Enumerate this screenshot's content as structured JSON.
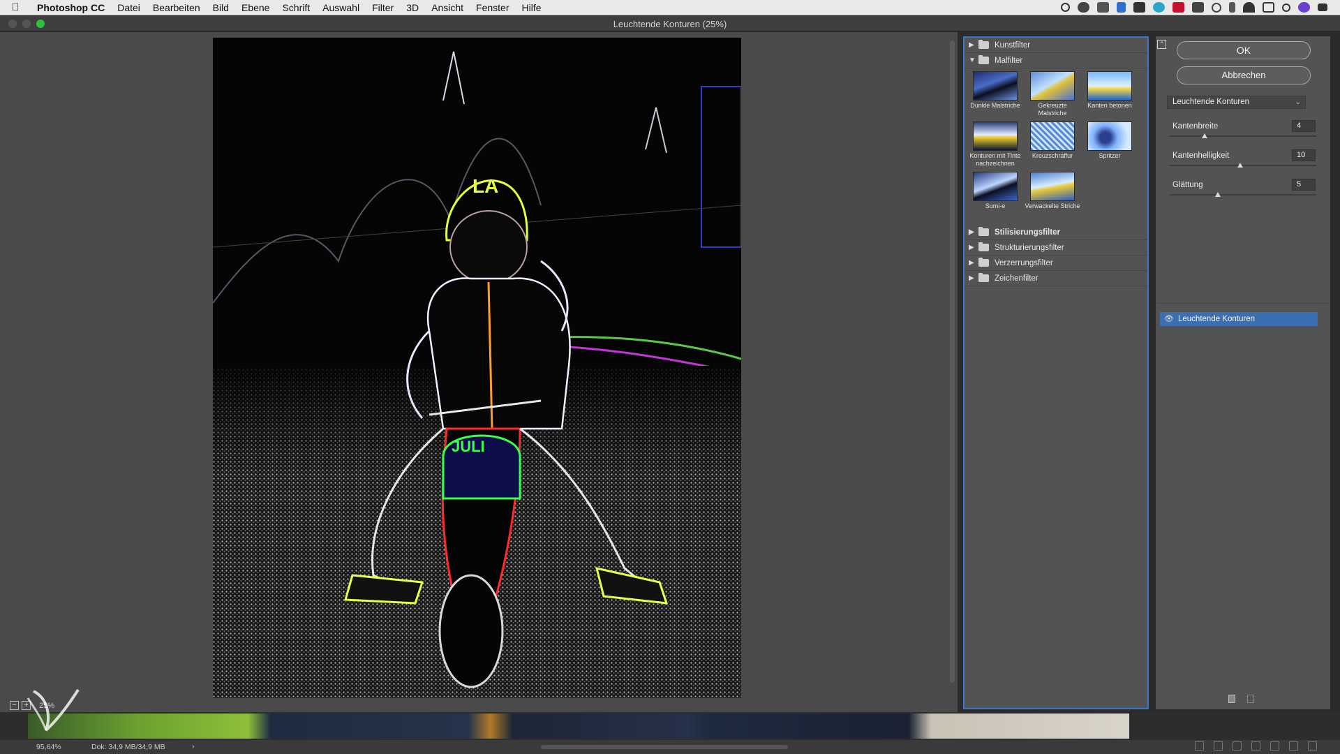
{
  "menubar": {
    "app": "Photoshop CC",
    "items": [
      "Datei",
      "Bearbeiten",
      "Bild",
      "Ebene",
      "Schrift",
      "Auswahl",
      "Filter",
      "3D",
      "Ansicht",
      "Fenster",
      "Hilfe"
    ],
    "tray_icons": [
      "record-icon",
      "creative-cloud-icon",
      "sync-icon",
      "dropbox-icon",
      "folder-icon",
      "globe-icon",
      "pdf-icon",
      "bell-icon",
      "time-machine-icon",
      "bluetooth-icon",
      "wifi-icon",
      "airplay-icon",
      "search-icon",
      "siri-icon",
      "list-icon"
    ]
  },
  "window": {
    "title": "Leuchtende Konturen (25%)"
  },
  "canvas": {
    "zoom_value": "25%",
    "preview_text": "JULI"
  },
  "gallery": {
    "categories": [
      {
        "label": "Kunstfilter",
        "expanded": false
      },
      {
        "label": "Malfilter",
        "expanded": true
      },
      {
        "label": "Stilisierungsfilter",
        "expanded": false
      },
      {
        "label": "Strukturierungsfilter",
        "expanded": false
      },
      {
        "label": "Verzerrungsfilter",
        "expanded": false
      },
      {
        "label": "Zeichenfilter",
        "expanded": false
      }
    ],
    "malfilter_items": [
      "Dunkle Malstriche",
      "Gekreuzte Malstriche",
      "Kanten betonen",
      "Konturen mit Tinte nachzeichnen",
      "Kreuzschraffur",
      "Spritzer",
      "Sumi-e",
      "Verwackelte Striche"
    ]
  },
  "settings": {
    "ok": "OK",
    "cancel": "Abbrechen",
    "selected_filter": "Leuchtende Konturen",
    "params": [
      {
        "label": "Kantenbreite",
        "value": "4",
        "fraction": 0.24
      },
      {
        "label": "Kantenhelligkeit",
        "value": "10",
        "fraction": 0.48
      },
      {
        "label": "Glättung",
        "value": "5",
        "fraction": 0.33
      }
    ],
    "effect_layer": "Leuchtende Konturen"
  },
  "status": {
    "zoom": "95,64%",
    "doc": "Dok: 34,9 MB/34,9 MB",
    "arrow": "›"
  },
  "colors": {
    "accent": "#3a76c8",
    "selected_row": "#3c6fb2",
    "neon_green": "#39ff4a",
    "neon_red": "#ff2a2a",
    "neon_yellow": "#ffd23a"
  }
}
